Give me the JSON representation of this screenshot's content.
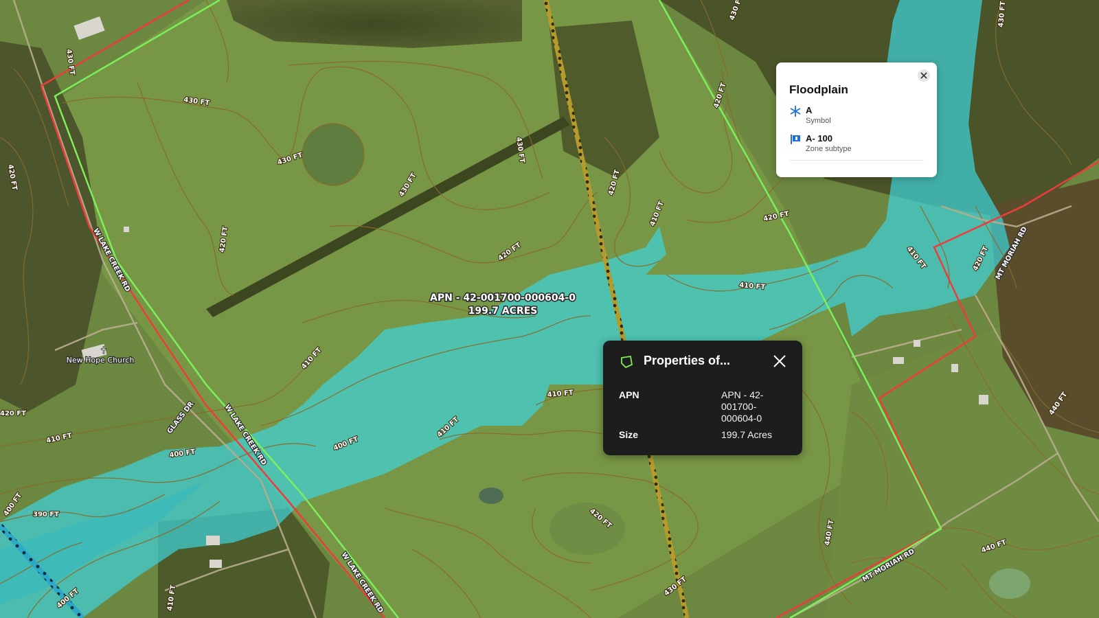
{
  "map": {
    "parcel_label": {
      "apn": "APN - 42-001700-000604-0",
      "size": "199.7 ACRES"
    },
    "poi": {
      "name": "New Hope Church"
    },
    "roads": [
      {
        "name": "W LAKE CREEK RD"
      },
      {
        "name": "W LAKE CREEK RD"
      },
      {
        "name": "W LAKE CREEK RD"
      },
      {
        "name": "GLASS DR"
      },
      {
        "name": "MT MORIAH RD"
      },
      {
        "name": "MT MORIAH RD"
      }
    ],
    "contours": [
      "430 FT",
      "430 FT",
      "430 FT",
      "430 FT",
      "430 FT",
      "430 FT",
      "430 FT",
      "430 FT",
      "420 FT",
      "420 FT",
      "420 FT",
      "420 FT",
      "420 FT",
      "420 FT",
      "420 FT",
      "420 FT",
      "420 FT",
      "410 FT",
      "410 FT",
      "410 FT",
      "410 FT",
      "410 FT",
      "410 FT",
      "410 FT",
      "410 FT",
      "400 FT",
      "400 FT",
      "400 FT",
      "400 FT",
      "390 FT",
      "440 FT",
      "440 FT",
      "440 FT"
    ],
    "colors": {
      "floodplain": "#3fd1d8",
      "parcel_boundary": "#7cf05a",
      "road_boundary": "#ee3b3b",
      "contour": "#8a6a2c"
    }
  },
  "floodplain_popup": {
    "title": "Floodplain",
    "close_icon": "close-icon",
    "rows": [
      {
        "icon": "asterisk-icon",
        "value": "A",
        "label": "Symbol"
      },
      {
        "icon": "flag-icon",
        "value": "A- 100",
        "label": "Zone subtype"
      }
    ]
  },
  "properties_popup": {
    "title": "Properties of...",
    "icon": "parcel-polygon-icon",
    "close_icon": "close-icon",
    "rows": [
      {
        "key": "APN",
        "value": "APN - 42-001700-000604-0"
      },
      {
        "key": "Size",
        "value": "199.7 Acres"
      }
    ]
  }
}
